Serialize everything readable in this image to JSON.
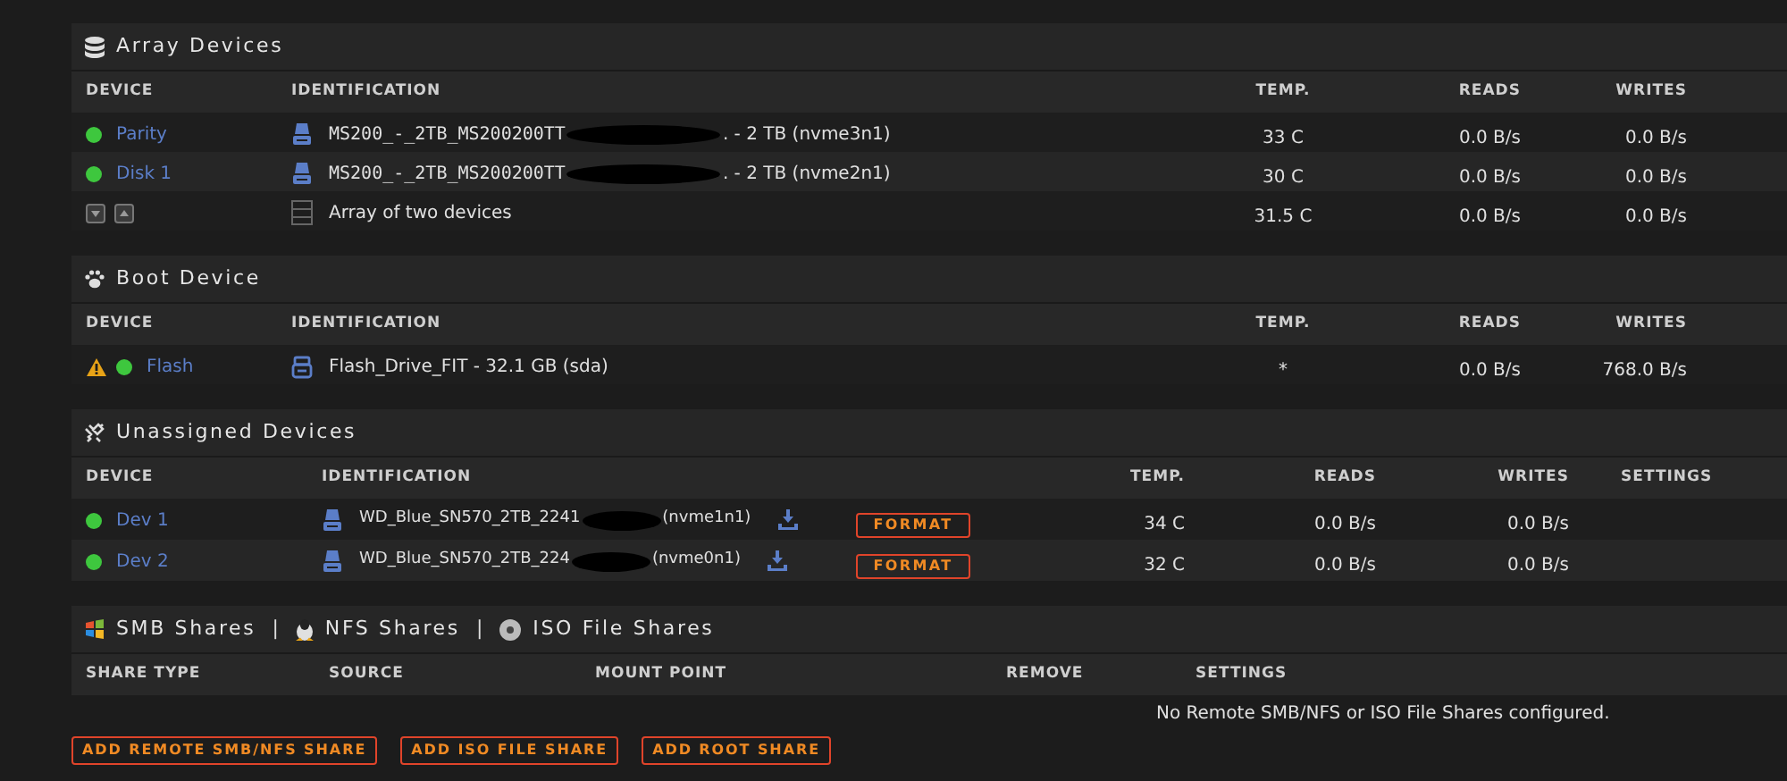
{
  "array_devices": {
    "title": "Array Devices",
    "columns": [
      "DEVICE",
      "IDENTIFICATION",
      "TEMP.",
      "READS",
      "WRITES"
    ],
    "rows": [
      {
        "kind": "disk",
        "online": true,
        "device": "Parity",
        "id_prefix": "MS200_-_2TB_MS200200TT",
        "redacted": true,
        "id_suffix": ". - 2 TB (nvme3n1)",
        "temp": "33 C",
        "reads": "0.0 B/s",
        "writes": "0.0 B/s"
      },
      {
        "kind": "disk",
        "online": true,
        "device": "Disk 1",
        "id_prefix": "MS200_-_2TB_MS200200TT",
        "redacted": true,
        "id_suffix": ". - 2 TB (nvme2n1)",
        "temp": "30 C",
        "reads": "0.0 B/s",
        "writes": "0.0 B/s"
      },
      {
        "kind": "summary",
        "id_prefix": "Array of two devices",
        "temp": "31.5 C",
        "reads": "0.0 B/s",
        "writes": "0.0 B/s"
      }
    ]
  },
  "boot_device": {
    "title": "Boot Device",
    "columns": [
      "DEVICE",
      "IDENTIFICATION",
      "TEMP.",
      "READS",
      "WRITES"
    ],
    "rows": [
      {
        "kind": "flash",
        "warning": true,
        "online": true,
        "device": "Flash",
        "id_prefix": "Flash_Drive_FIT - 32.1 GB (sda)",
        "temp": "*",
        "reads": "0.0 B/s",
        "writes": "768.0 B/s"
      }
    ]
  },
  "unassigned_devices": {
    "title": "Unassigned Devices",
    "columns": [
      "DEVICE",
      "IDENTIFICATION",
      "",
      "TEMP.",
      "READS",
      "WRITES",
      "SETTINGS"
    ],
    "rows": [
      {
        "online": true,
        "device": "Dev 1",
        "id_prefix": "WD_Blue_SN570_2TB_2241",
        "redacted": true,
        "id_suffix": "(nvme1n1)",
        "button": "FORMAT",
        "temp": "34 C",
        "reads": "0.0 B/s",
        "writes": "0.0 B/s"
      },
      {
        "online": true,
        "device": "Dev 2",
        "id_prefix": "WD_Blue_SN570_2TB_224",
        "redacted": true,
        "id_suffix": "(nvme0n1)",
        "button": "FORMAT",
        "temp": "32 C",
        "reads": "0.0 B/s",
        "writes": "0.0 B/s"
      }
    ]
  },
  "shares": {
    "tabs": [
      {
        "kind": "smb",
        "label": "SMB Shares"
      },
      {
        "kind": "nfs",
        "separator": "|",
        "label": "NFS Shares"
      },
      {
        "kind": "iso",
        "separator": "|",
        "label": "ISO File Shares"
      }
    ],
    "columns": [
      "SHARE TYPE",
      "SOURCE",
      "MOUNT POINT",
      "REMOVE",
      "SETTINGS"
    ],
    "message": "No Remote SMB/NFS or ISO File Shares configured.",
    "buttons": [
      "ADD REMOTE SMB/NFS SHARE",
      "ADD ISO FILE SHARE",
      "ADD ROOT SHARE"
    ]
  }
}
